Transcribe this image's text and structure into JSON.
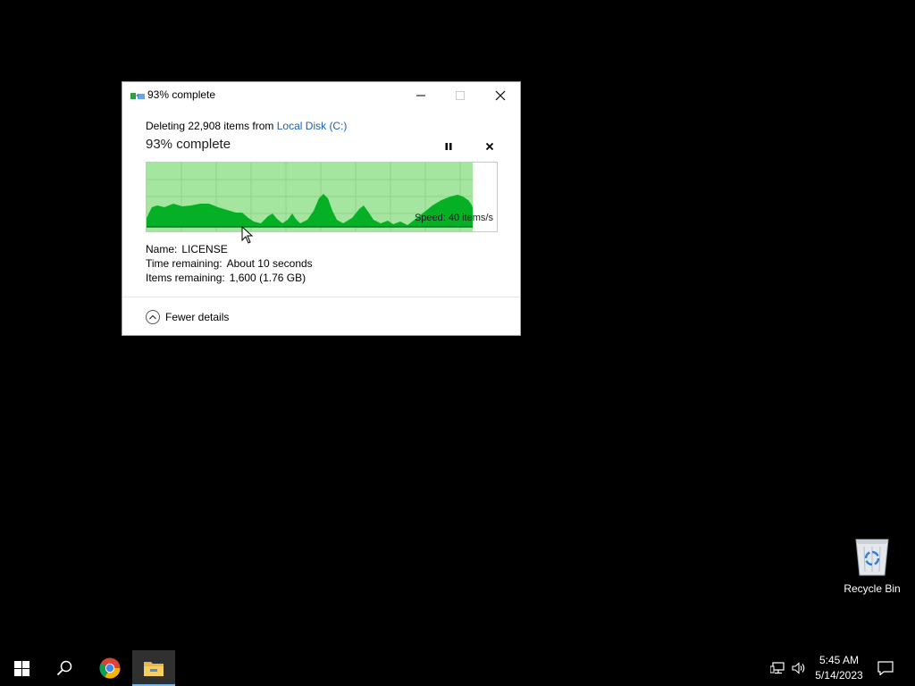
{
  "dialog": {
    "title": "93% complete",
    "operation_prefix": "Deleting 22,908 items from",
    "operation_location": "Local Disk (C:)",
    "heading": "93% complete",
    "progress_fraction": 0.93,
    "speed_text": "Speed: 40 items/s",
    "details": {
      "name_label": "Name:",
      "name_value": "LICENSE",
      "time_label": "Time remaining:",
      "time_value": "About 10 seconds",
      "items_label": "Items remaining:",
      "items_value": "1,600 (1.76 GB)"
    },
    "fewer_details": "Fewer details",
    "icons": {
      "title": "file-copy-icon",
      "pause": "pause-icon",
      "cancel": "close-icon",
      "fewer": "chevron-up-icon"
    }
  },
  "desktop": {
    "recycle_bin_label": "Recycle Bin"
  },
  "taskbar": {
    "time": "5:45 AM",
    "date": "5/14/2023",
    "items": [
      "windows-start-icon",
      "search-icon",
      "chrome-icon",
      "file-explorer-icon"
    ],
    "tray": [
      "network-icon",
      "volume-icon",
      "notification-icon"
    ]
  },
  "colors": {
    "graph_fill_light": "#a4e5a0",
    "graph_fill_dark": "#06b025",
    "link": "#1a5fb4",
    "taskbar_active_underline": "#76b9ed"
  }
}
